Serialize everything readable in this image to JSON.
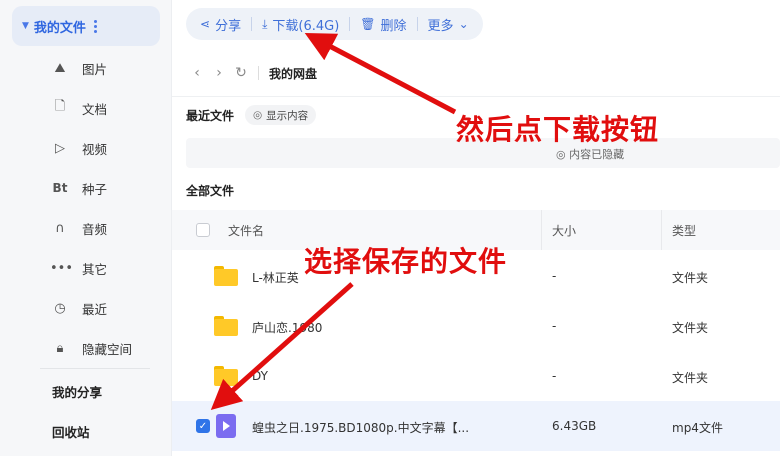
{
  "sidebar": {
    "title": "我的文件",
    "items": [
      {
        "icon": "cloud-icon",
        "label": "图片"
      },
      {
        "icon": "document-icon",
        "label": "文档"
      },
      {
        "icon": "play-icon",
        "label": "视频"
      },
      {
        "icon": "bt-icon",
        "label": "种子"
      },
      {
        "icon": "headphones-icon",
        "label": "音频"
      },
      {
        "icon": "dots-icon",
        "label": "其它"
      },
      {
        "icon": "clock-icon",
        "label": "最近"
      },
      {
        "icon": "lock-icon",
        "label": "隐藏空间"
      }
    ],
    "my_share": "我的分享",
    "recycle": "回收站"
  },
  "toolbar": {
    "share": "分享",
    "download": "下载(6.4G)",
    "delete": "删除",
    "more": "更多"
  },
  "nav": {
    "breadcrumb": "我的网盘"
  },
  "recent": {
    "title": "最近文件",
    "show_label": "显示内容",
    "hidden_label": "内容已隐藏"
  },
  "files": {
    "title": "全部文件",
    "columns": {
      "name": "文件名",
      "size": "大小",
      "type": "类型"
    },
    "rows": [
      {
        "name": "L-林正英",
        "size": "-",
        "type": "文件夹",
        "kind": "folder",
        "selected": false
      },
      {
        "name": "庐山恋.1980",
        "size": "-",
        "type": "文件夹",
        "kind": "folder",
        "selected": false
      },
      {
        "name": "DY",
        "size": "-",
        "type": "文件夹",
        "kind": "folder",
        "selected": false
      },
      {
        "name": "蝗虫之日.1975.BD1080p.中文字幕【...",
        "size": "6.43GB",
        "type": "mp4文件",
        "kind": "video",
        "selected": true
      }
    ]
  },
  "annotations": {
    "top": "然后点下载按钮",
    "middle": "选择保存的文件",
    "color": "#e10e0e"
  }
}
